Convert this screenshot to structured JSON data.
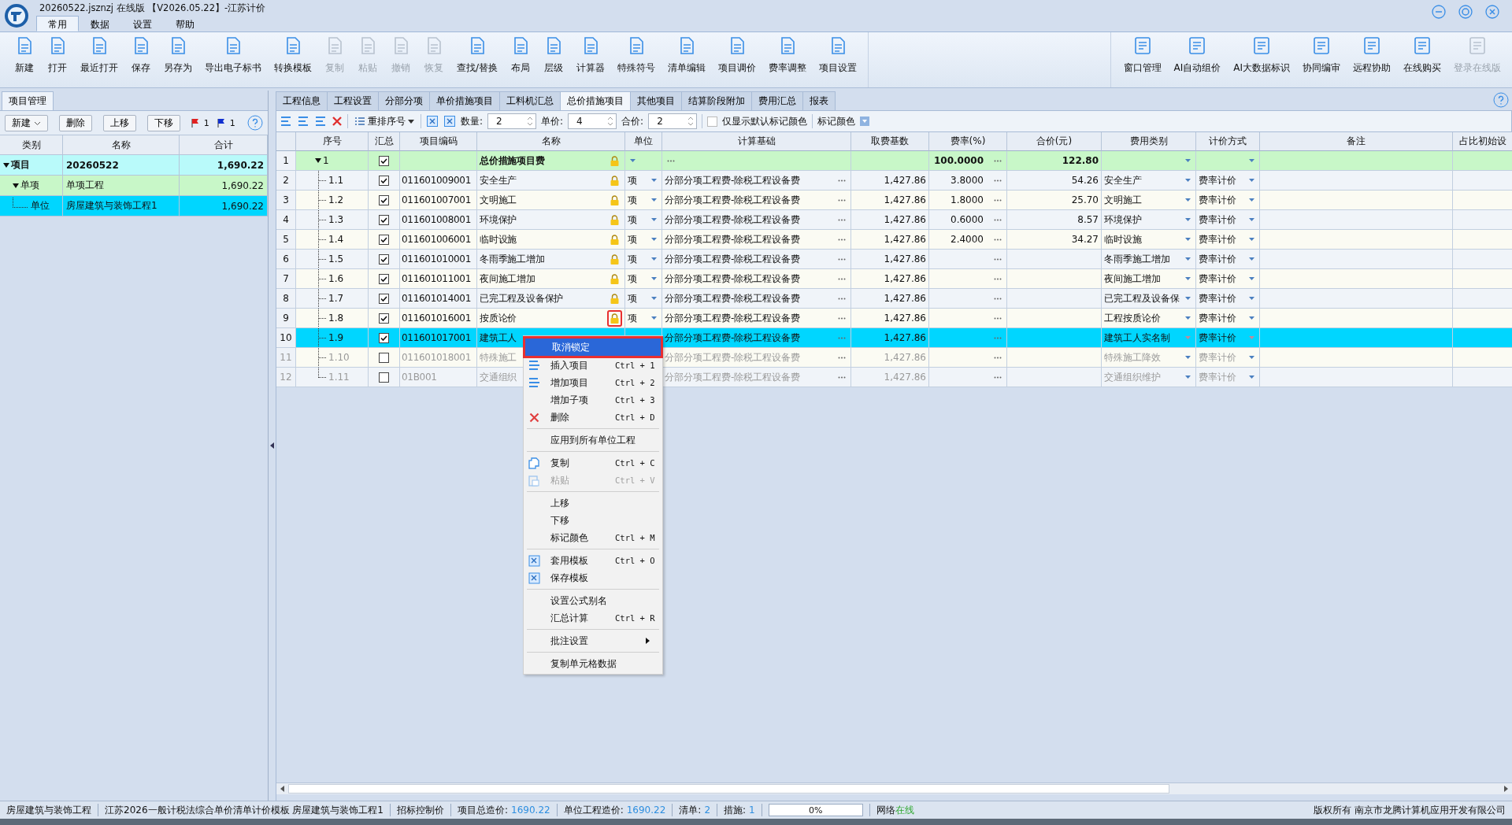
{
  "window": {
    "title": "20260522.jsznzj 在线版 【V2026.05.22】-江苏计价"
  },
  "menu_tabs": [
    {
      "label": "常用",
      "selected": true
    },
    {
      "label": "数据",
      "selected": false
    },
    {
      "label": "设置",
      "selected": false
    },
    {
      "label": "帮助",
      "selected": false
    }
  ],
  "ribbon_left": [
    {
      "label": "新建",
      "disabled": false
    },
    {
      "label": "打开",
      "disabled": false
    },
    {
      "label": "最近打开",
      "disabled": false
    },
    {
      "label": "保存",
      "disabled": false
    },
    {
      "label": "另存为",
      "disabled": false
    },
    {
      "label": "导出电子标书",
      "disabled": false
    },
    {
      "label": "转换模板",
      "disabled": false
    },
    {
      "label": "复制",
      "disabled": true
    },
    {
      "label": "粘贴",
      "disabled": true
    },
    {
      "label": "撤销",
      "disabled": true
    },
    {
      "label": "恢复",
      "disabled": true
    },
    {
      "label": "查找/替换",
      "disabled": false
    },
    {
      "label": "布局",
      "disabled": false
    },
    {
      "label": "层级",
      "disabled": false
    },
    {
      "label": "计算器",
      "disabled": false
    },
    {
      "label": "特殊符号",
      "disabled": false
    },
    {
      "label": "清单编辑",
      "disabled": false
    },
    {
      "label": "项目调价",
      "disabled": false
    },
    {
      "label": "费率调整",
      "disabled": false
    },
    {
      "label": "项目设置",
      "disabled": false
    }
  ],
  "ribbon_right": [
    {
      "label": "窗口管理",
      "disabled": false
    },
    {
      "label": "AI自动组价",
      "disabled": false
    },
    {
      "label": "AI大数据标识",
      "disabled": false
    },
    {
      "label": "协同编审",
      "disabled": false
    },
    {
      "label": "远程协助",
      "disabled": false
    },
    {
      "label": "在线购买",
      "disabled": false
    },
    {
      "label": "登录在线版",
      "disabled": true
    }
  ],
  "left_panel": {
    "tab": "项目管理",
    "buttons": [
      "新建",
      "删除",
      "上移",
      "下移"
    ],
    "red_flag_count": "1",
    "blue_flag_count": "1",
    "columns": [
      "类别",
      "名称",
      "合计"
    ],
    "rows": [
      {
        "kind": "project",
        "category": "项目",
        "name": "20260522",
        "total": "1,690.22",
        "selected": false
      },
      {
        "kind": "single",
        "category": "单项",
        "name": "单项工程",
        "total": "1,690.22",
        "selected": false
      },
      {
        "kind": "unit",
        "category": "单位",
        "name": "房屋建筑与装饰工程1",
        "total": "1,690.22",
        "selected": true
      }
    ]
  },
  "content_tabs": [
    {
      "label": "工程信息",
      "selected": false
    },
    {
      "label": "工程设置",
      "selected": false
    },
    {
      "label": "分部分项",
      "selected": false
    },
    {
      "label": "单价措施项目",
      "selected": false
    },
    {
      "label": "工料机汇总",
      "selected": false
    },
    {
      "label": "总价措施项目",
      "selected": true
    },
    {
      "label": "其他项目",
      "selected": false
    },
    {
      "label": "结算阶段附加",
      "selected": false
    },
    {
      "label": "费用汇总",
      "selected": false
    },
    {
      "label": "报表",
      "selected": false
    }
  ],
  "toolbar": {
    "renumber": "重排序号",
    "quantity_label": "数量:",
    "quantity": "2",
    "price_label": "单价:",
    "price": "4",
    "total_label": "合价:",
    "total": "2",
    "default_color_only": {
      "label": "仅显示默认标记颜色",
      "checked": false
    },
    "mark_color": "标记颜色"
  },
  "table": {
    "columns": [
      "序号",
      "汇总",
      "项目编码",
      "名称",
      "单位",
      "计算基础",
      "取费基数",
      "费率(%)",
      "合价(元)",
      "费用类别",
      "计价方式",
      "备注",
      "占比初始设"
    ],
    "rows": [
      {
        "num": "1",
        "seq": "1",
        "top": true,
        "checked": true,
        "code": "",
        "name": "总价措施项目费",
        "locked": true,
        "lock_highlighted": false,
        "unit": "",
        "base": "",
        "base_amount": "",
        "rate": "100.0000",
        "total": "122.80",
        "category": "",
        "method": "",
        "selected": false,
        "disabled": false
      },
      {
        "num": "2",
        "seq": "1.1",
        "top": false,
        "checked": true,
        "code": "011601009001",
        "name": "安全生产",
        "locked": true,
        "lock_highlighted": false,
        "unit": "项",
        "base": "分部分项工程费-除税工程设备费",
        "base_amount": "1,427.86",
        "rate": "3.8000",
        "total": "54.26",
        "category": "安全生产",
        "method": "费率计价",
        "selected": false,
        "disabled": false
      },
      {
        "num": "3",
        "seq": "1.2",
        "top": false,
        "checked": true,
        "code": "011601007001",
        "name": "文明施工",
        "locked": true,
        "lock_highlighted": false,
        "unit": "项",
        "base": "分部分项工程费-除税工程设备费",
        "base_amount": "1,427.86",
        "rate": "1.8000",
        "total": "25.70",
        "category": "文明施工",
        "method": "费率计价",
        "selected": false,
        "disabled": false
      },
      {
        "num": "4",
        "seq": "1.3",
        "top": false,
        "checked": true,
        "code": "011601008001",
        "name": "环境保护",
        "locked": true,
        "lock_highlighted": false,
        "unit": "项",
        "base": "分部分项工程费-除税工程设备费",
        "base_amount": "1,427.86",
        "rate": "0.6000",
        "total": "8.57",
        "category": "环境保护",
        "method": "费率计价",
        "selected": false,
        "disabled": false
      },
      {
        "num": "5",
        "seq": "1.4",
        "top": false,
        "checked": true,
        "code": "011601006001",
        "name": "临时设施",
        "locked": true,
        "lock_highlighted": false,
        "unit": "项",
        "base": "分部分项工程费-除税工程设备费",
        "base_amount": "1,427.86",
        "rate": "2.4000",
        "total": "34.27",
        "category": "临时设施",
        "method": "费率计价",
        "selected": false,
        "disabled": false
      },
      {
        "num": "6",
        "seq": "1.5",
        "top": false,
        "checked": true,
        "code": "011601010001",
        "name": "冬雨季施工增加",
        "locked": true,
        "lock_highlighted": false,
        "unit": "项",
        "base": "分部分项工程费-除税工程设备费",
        "base_amount": "1,427.86",
        "rate": "",
        "total": "",
        "category": "冬雨季施工增加",
        "method": "费率计价",
        "selected": false,
        "disabled": false
      },
      {
        "num": "7",
        "seq": "1.6",
        "top": false,
        "checked": true,
        "code": "011601011001",
        "name": "夜间施工增加",
        "locked": true,
        "lock_highlighted": false,
        "unit": "项",
        "base": "分部分项工程费-除税工程设备费",
        "base_amount": "1,427.86",
        "rate": "",
        "total": "",
        "category": "夜间施工增加",
        "method": "费率计价",
        "selected": false,
        "disabled": false
      },
      {
        "num": "8",
        "seq": "1.7",
        "top": false,
        "checked": true,
        "code": "011601014001",
        "name": "已完工程及设备保护",
        "locked": true,
        "lock_highlighted": false,
        "unit": "项",
        "base": "分部分项工程费-除税工程设备费",
        "base_amount": "1,427.86",
        "rate": "",
        "total": "",
        "category": "已完工程及设备保",
        "method": "费率计价",
        "selected": false,
        "disabled": false
      },
      {
        "num": "9",
        "seq": "1.8",
        "top": false,
        "checked": true,
        "code": "011601016001",
        "name": "按质论价",
        "locked": true,
        "lock_highlighted": true,
        "unit": "项",
        "base": "分部分项工程费-除税工程设备费",
        "base_amount": "1,427.86",
        "rate": "",
        "total": "",
        "category": "工程按质论价",
        "method": "费率计价",
        "selected": false,
        "disabled": false
      },
      {
        "num": "10",
        "seq": "1.9",
        "top": false,
        "checked": true,
        "code": "011601017001",
        "name": "建筑工人",
        "base": "分部分项工程费-除税工程设备费",
        "base_amount": "1,427.86",
        "rate": "",
        "total": "",
        "category": "建筑工人实名制",
        "method": "费率计价",
        "selected": true,
        "disabled": false
      },
      {
        "num": "11",
        "seq": "1.10",
        "top": false,
        "checked": false,
        "code": "011601018001",
        "name": "特殊施工",
        "base": "分部分项工程费-除税工程设备费",
        "base_amount": "1,427.86",
        "rate": "",
        "total": "",
        "category": "特殊施工降效",
        "method": "费率计价",
        "selected": false,
        "disabled": true
      },
      {
        "num": "12",
        "seq": "1.11",
        "top": false,
        "checked": false,
        "code": "01B001",
        "name": "交通组织",
        "base": "分部分项工程费-除税工程设备费",
        "base_amount": "1,427.86",
        "rate": "",
        "total": "",
        "category": "交通组织维护",
        "method": "费率计价",
        "selected": false,
        "disabled": true
      }
    ]
  },
  "context_menu": [
    {
      "kind": "item",
      "label": "取消锁定",
      "selected": true,
      "disabled": false
    },
    {
      "kind": "item",
      "label": "插入项目",
      "shortcut": "Ctrl + 1",
      "selected": false,
      "disabled": false
    },
    {
      "kind": "item",
      "label": "增加项目",
      "shortcut": "Ctrl + 2",
      "selected": false,
      "disabled": false
    },
    {
      "kind": "item",
      "label": "增加子项",
      "shortcut": "Ctrl + 3",
      "selected": false,
      "disabled": false
    },
    {
      "kind": "item",
      "label": "删除",
      "shortcut": "Ctrl + D",
      "selected": false,
      "disabled": false
    },
    {
      "kind": "separator"
    },
    {
      "kind": "item",
      "label": "应用到所有单位工程",
      "selected": false,
      "disabled": false
    },
    {
      "kind": "separator"
    },
    {
      "kind": "item",
      "label": "复制",
      "shortcut": "Ctrl + C",
      "selected": false,
      "disabled": false
    },
    {
      "kind": "item",
      "label": "粘贴",
      "shortcut": "Ctrl + V",
      "selected": false,
      "disabled": true
    },
    {
      "kind": "separator"
    },
    {
      "kind": "item",
      "label": "上移",
      "selected": false,
      "disabled": false
    },
    {
      "kind": "item",
      "label": "下移",
      "selected": false,
      "disabled": false
    },
    {
      "kind": "item",
      "label": "标记颜色",
      "shortcut": "Ctrl + M",
      "selected": false,
      "disabled": false
    },
    {
      "kind": "separator"
    },
    {
      "kind": "item",
      "label": "套用模板",
      "shortcut": "Ctrl + O",
      "selected": false,
      "disabled": false
    },
    {
      "kind": "item",
      "label": "保存模板",
      "selected": false,
      "disabled": false
    },
    {
      "kind": "separator"
    },
    {
      "kind": "item",
      "label": "设置公式别名",
      "selected": false,
      "disabled": false
    },
    {
      "kind": "item",
      "label": "汇总计算",
      "shortcut": "Ctrl + R",
      "selected": false,
      "disabled": false
    },
    {
      "kind": "separator"
    },
    {
      "kind": "submenu",
      "label": "批注设置",
      "selected": false,
      "disabled": false
    },
    {
      "kind": "separator"
    },
    {
      "kind": "item",
      "label": "复制单元格数据",
      "selected": false,
      "disabled": false
    }
  ],
  "status_bar": {
    "project": "房屋建筑与装饰工程",
    "template": "江苏2026一般计税法综合单价清单计价模板 房屋建筑与装饰工程1",
    "mode": "招标控制价",
    "project_cost_label": "项目总造价:",
    "project_cost": "1690.22",
    "unit_cost_label": "单位工程造价:",
    "unit_cost": "1690.22",
    "list_label": "清单:",
    "list_count": "2",
    "measure_label": "措施:",
    "measure_count": "1",
    "progress": {
      "level": 0,
      "reading": "0%"
    },
    "network_label": "网络",
    "network_status": "在线",
    "copyright": "版权所有  南京市龙腾计算机应用开发有限公司"
  }
}
